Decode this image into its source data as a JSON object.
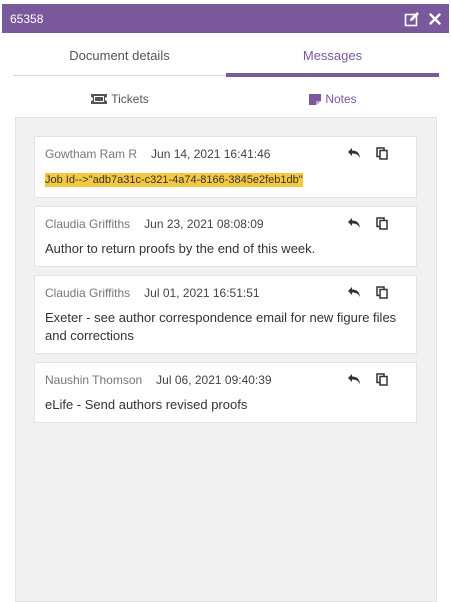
{
  "window": {
    "title": "65358",
    "edit_icon": "edit-icon",
    "close_icon": "close-icon",
    "accent_color": "#7a589c"
  },
  "tabs": [
    {
      "label": "Document details",
      "active": false
    },
    {
      "label": "Messages",
      "active": true
    }
  ],
  "subtabs": [
    {
      "label": "Tickets",
      "icon": "ticket-icon",
      "active": false
    },
    {
      "label": "Notes",
      "icon": "note-icon",
      "active": true
    }
  ],
  "notes": [
    {
      "author": "Gowtham Ram R",
      "date": "Jun 14, 2021 16:41:46",
      "text": "Job Id-->\"adb7a31c-c321-4a74-8166-3845e2feb1db\"",
      "highlighted": true
    },
    {
      "author": "Claudia Griffiths",
      "date": "Jun 23, 2021 08:08:09",
      "text": "Author to return proofs by the end of this week.",
      "highlighted": false
    },
    {
      "author": "Claudia Griffiths",
      "date": "Jul 01, 2021 16:51:51",
      "text": "Exeter - see author correspondence email for new figure files and corrections",
      "highlighted": false
    },
    {
      "author": "Naushin Thomson",
      "date": "Jul 06, 2021 09:40:39",
      "text": "eLife - Send authors revised proofs",
      "highlighted": false
    }
  ],
  "note_actions": {
    "reply_icon": "reply-icon",
    "copy_icon": "copy-icon"
  }
}
